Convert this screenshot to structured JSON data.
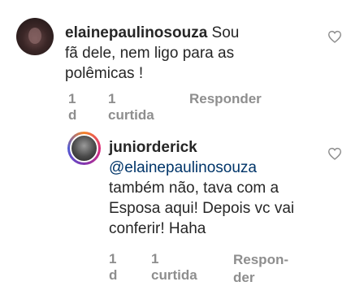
{
  "comments": [
    {
      "username": "elainepaulinosouza",
      "text": " Sou fã dele, nem ligo para as polêmicas !",
      "time": "1 d",
      "likes": "1 curtida",
      "reply_label": "Responder"
    },
    {
      "username": "juniorderick",
      "mention": "@elainepaulinosouza",
      "text": "também não, tava com a Esposa aqui! Depois vc vai conferir! Haha",
      "time": "1 d",
      "likes": "1 curtida",
      "reply_label": "Respon-der"
    }
  ],
  "colors": {
    "meta": "#8e8e8e",
    "mention": "#003569",
    "text": "#262626"
  }
}
